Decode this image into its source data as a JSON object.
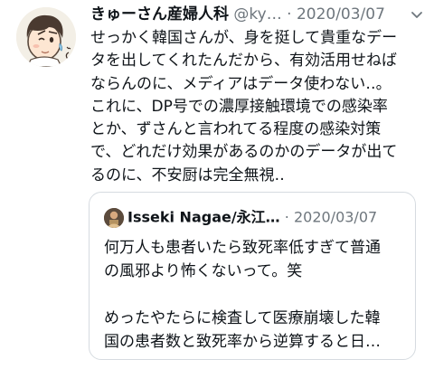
{
  "tweet": {
    "display_name": "きゅーさん産婦人科",
    "handle": "@ky…",
    "separator": " · ",
    "date": "2020/03/07",
    "avatar_icon": "cartoon-doctor-avatar",
    "menu_icon": "chevron-down-icon",
    "lines": [
      "せっかく韓国さんが、身を挺して貴重なデー",
      "タを出してくれたんだから、有効活用せねば",
      "ならんのに、メディアはデータ使わない‥。",
      "これに、DP号での濃厚接触環境での感染率",
      "とか、ずさんと言われてる程度の感染対策",
      "で、どれだけ効果があるのかのデータが出て",
      "るのに、不安厨は完全無視‥"
    ]
  },
  "quote": {
    "display_name": "Isseki Nagae/永江…",
    "separator": " · ",
    "date": "2020/03/07",
    "avatar_icon": "profile-photo-avatar",
    "lines": [
      "何万人も患者いたら致死率低すぎて普通",
      "の風邪より怖くないって。笑",
      "",
      "めったやたらに検査して医療崩壊した韓",
      "国の患者数と致死率から逆算すると日…"
    ]
  },
  "colors": {
    "text": "#0f1419",
    "secondary": "#6e767d",
    "border": "#d6dbe0",
    "background": "#ffffff"
  }
}
